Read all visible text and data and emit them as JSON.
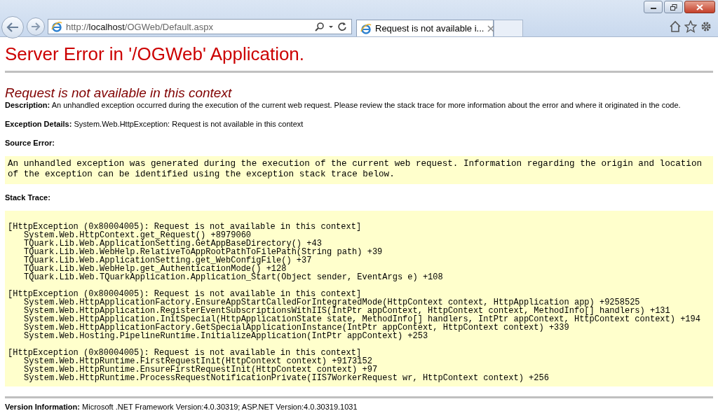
{
  "browser": {
    "address": "http://**localhost**/OGWeb/Default.aspx",
    "tabs": [
      {
        "title": "Request is not available i...",
        "selected": true
      }
    ]
  },
  "page": {
    "title": "Server Error in '/OGWeb' Application.",
    "error_heading": "Request is not available in this context",
    "description": {
      "label": "Description:",
      "text": "An unhandled exception occurred during the execution of the current web request. Please review the stack trace for more information about the error and where it originated in the code."
    },
    "exception_details": {
      "label": "Exception Details:",
      "text": "System.Web.HttpException: Request is not available in this context"
    },
    "source_error": {
      "label": "Source Error:",
      "text": "An unhandled exception was generated during the execution of the current web request. Information regarding the origin and location of the exception can be identified using the exception stack trace below."
    },
    "stack_trace": {
      "label": "Stack Trace:",
      "groups": [
        {
          "header": "[HttpException (0x80004005): Request is not available in this context]",
          "frames": [
            "System.Web.HttpContext.get_Request() +8979060",
            "TQuark.Lib.Web.ApplicationSetting.GetAppBaseDirectory() +43",
            "TQuark.Lib.Web.WebHelp.RelativeToAppRootPathToFilePath(String path) +39",
            "TQuark.Lib.Web.ApplicationSetting.get_WebConfigFile() +37",
            "TQuark.Lib.Web.WebHelp.get_AuthenticationMode() +128",
            "TQuark.Lib.Web.TQuarkApplication.Application_Start(Object sender, EventArgs e) +108"
          ]
        },
        {
          "header": "[HttpException (0x80004005): Request is not available in this context]",
          "frames": [
            "System.Web.HttpApplicationFactory.EnsureAppStartCalledForIntegratedMode(HttpContext context, HttpApplication app) +9258525",
            "System.Web.HttpApplication.RegisterEventSubscriptionsWithIIS(IntPtr appContext, HttpContext context, MethodInfo[] handlers) +131",
            "System.Web.HttpApplication.InitSpecial(HttpApplicationState state, MethodInfo[] handlers, IntPtr appContext, HttpContext context) +194",
            "System.Web.HttpApplicationFactory.GetSpecialApplicationInstance(IntPtr appContext, HttpContext context) +339",
            "System.Web.Hosting.PipelineRuntime.InitializeApplication(IntPtr appContext) +253"
          ]
        },
        {
          "header": "[HttpException (0x80004005): Request is not available in this context]",
          "frames": [
            "System.Web.HttpRuntime.FirstRequestInit(HttpContext context) +9173152",
            "System.Web.HttpRuntime.EnsureFirstRequestInit(HttpContext context) +97",
            "System.Web.HttpRuntime.ProcessRequestNotificationPrivate(IIS7WorkerRequest wr, HttpContext context) +256"
          ]
        }
      ]
    },
    "version_info": {
      "label": "Version Information:",
      "text": "Microsoft .NET Framework Version:4.0.30319; ASP.NET Version:4.0.30319.1031"
    }
  }
}
